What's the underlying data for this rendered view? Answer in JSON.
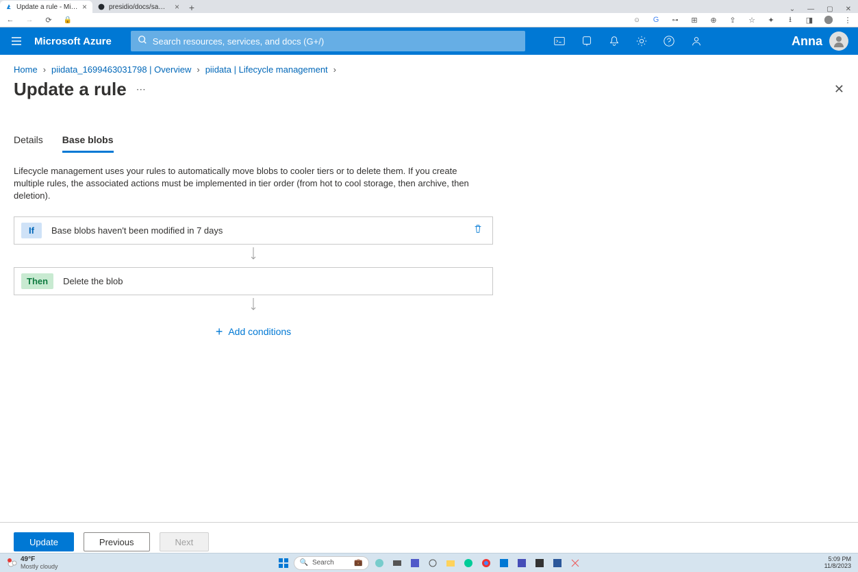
{
  "browser": {
    "tabs": [
      {
        "title": "Update a rule - Microsoft Azure",
        "active": true
      },
      {
        "title": "presidio/docs/samples/deploy",
        "active": false
      }
    ]
  },
  "azure": {
    "brand": "Microsoft Azure",
    "search_placeholder": "Search resources, services, and docs (G+/)",
    "user_name": "Anna"
  },
  "breadcrumb": {
    "items": [
      "Home",
      "piidata_1699463031798 | Overview",
      "piidata | Lifecycle management"
    ]
  },
  "page": {
    "title": "Update a rule"
  },
  "tabs": {
    "details": "Details",
    "base_blobs": "Base blobs"
  },
  "description": "Lifecycle management uses your rules to automatically move blobs to cooler tiers or to delete them. If you create multiple rules, the associated actions must be implemented in tier order (from hot to cool storage, then archive, then deletion).",
  "rule": {
    "if_badge": "If",
    "if_text": "Base blobs haven't been modified in 7 days",
    "then_badge": "Then",
    "then_text": "Delete the blob",
    "add_conditions": "Add conditions"
  },
  "footer": {
    "update": "Update",
    "previous": "Previous",
    "next": "Next"
  },
  "taskbar": {
    "temp": "49°F",
    "weather": "Mostly cloudy",
    "search": "Search",
    "time": "5:09 PM",
    "date": "11/8/2023"
  }
}
